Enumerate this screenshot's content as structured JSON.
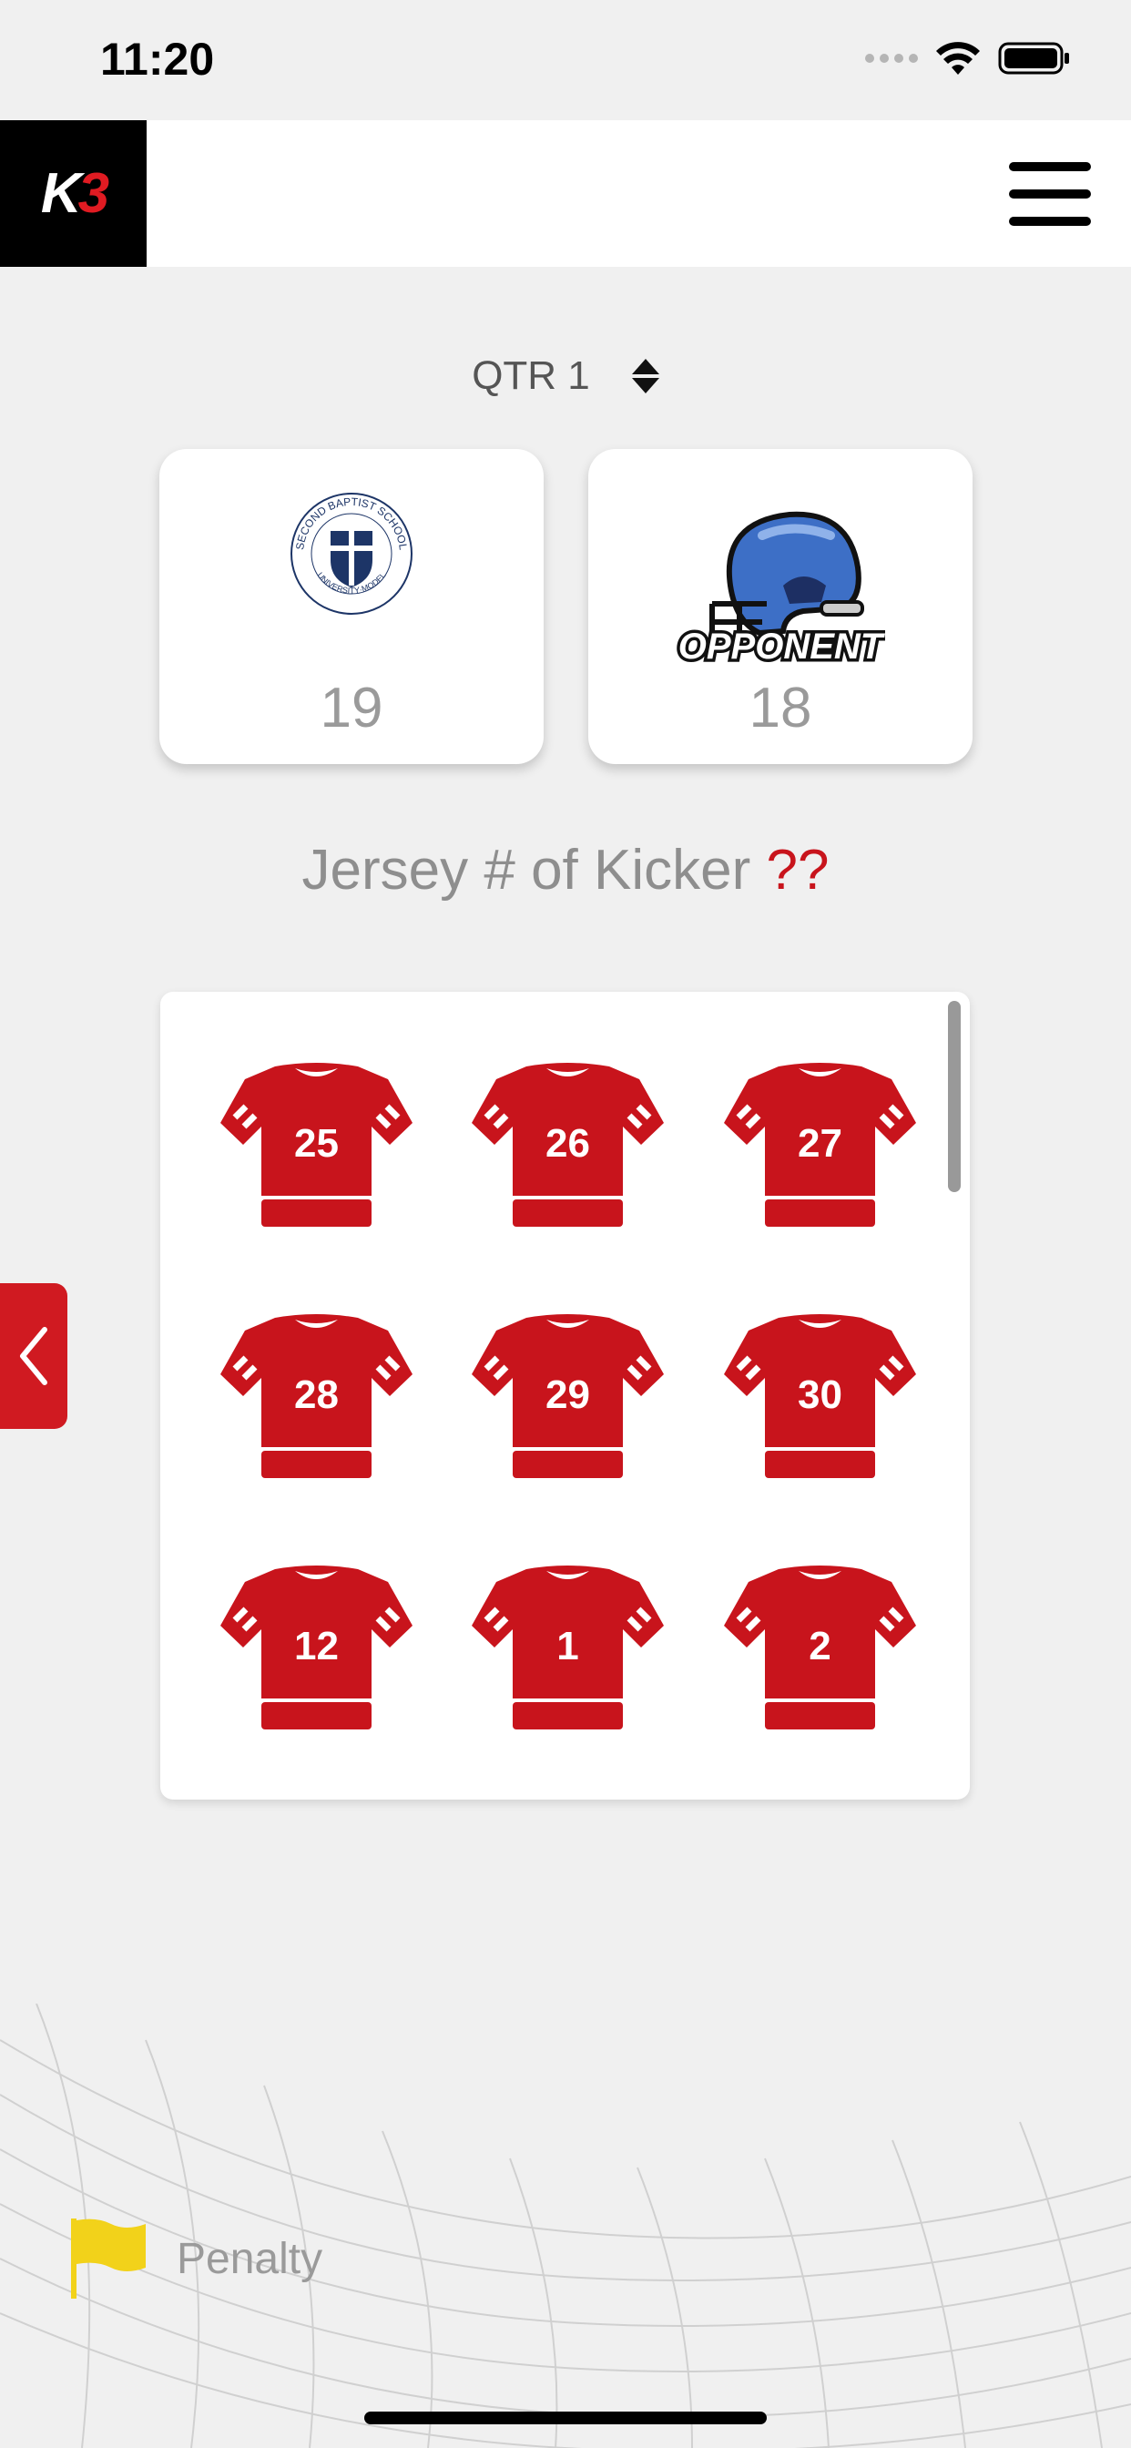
{
  "status_bar": {
    "time": "11:20"
  },
  "header": {
    "logo_text_white": "K",
    "logo_text_red": "3"
  },
  "quarter": {
    "label": "QTR 1"
  },
  "teams": {
    "home": {
      "score": "19",
      "seal_text": "SECOND BAPTIST SCHOOL",
      "seal_subtext": "UNIVERSITY·MODEL"
    },
    "away": {
      "score": "18",
      "logo_text": "OPPONENT"
    }
  },
  "question": {
    "text": "Jersey # of Kicker",
    "marker": "??"
  },
  "jerseys": [
    "25",
    "26",
    "27",
    "28",
    "29",
    "30",
    "12",
    "1",
    "2"
  ],
  "penalty": {
    "label": "Penalty"
  },
  "colors": {
    "jersey_red": "#c8141c",
    "flag_yellow": "#f2d21a",
    "helmet_blue": "#3d6fc6",
    "seal_navy": "#1d3567"
  }
}
